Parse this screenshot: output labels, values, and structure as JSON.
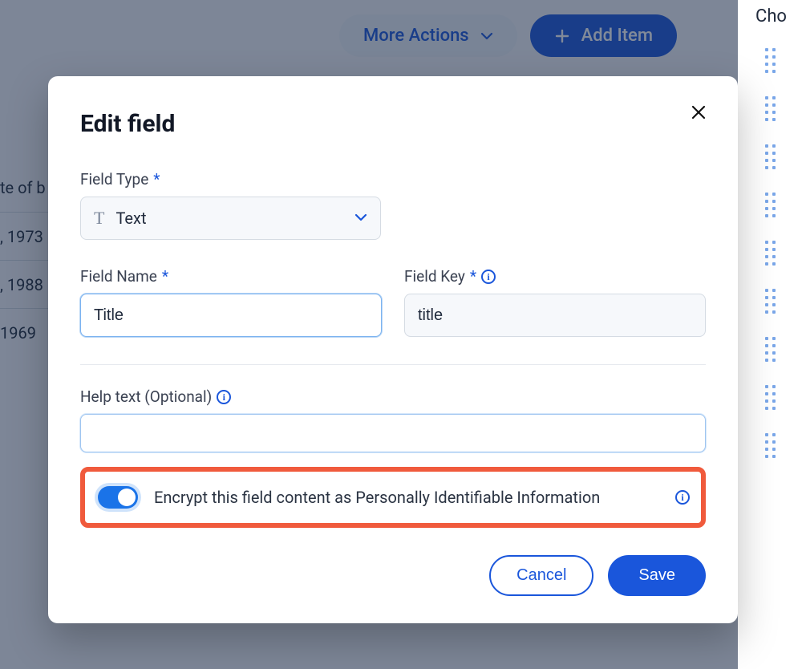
{
  "background": {
    "more_actions_label": "More Actions",
    "add_item_label": "Add Item",
    "right_panel_title": "Cho",
    "partial_header": "te of b",
    "partial_rows": [
      ", 1973",
      ", 1988",
      "1969"
    ]
  },
  "modal": {
    "title": "Edit field",
    "field_type": {
      "label": "Field Type",
      "selected": "Text"
    },
    "field_name": {
      "label": "Field Name",
      "value": "Title"
    },
    "field_key": {
      "label": "Field Key",
      "value": "title"
    },
    "help_text": {
      "label": "Help text (Optional)",
      "value": ""
    },
    "encrypt": {
      "label": "Encrypt this field content as Personally Identifiable Information",
      "enabled": true
    },
    "buttons": {
      "cancel": "Cancel",
      "save": "Save"
    }
  }
}
